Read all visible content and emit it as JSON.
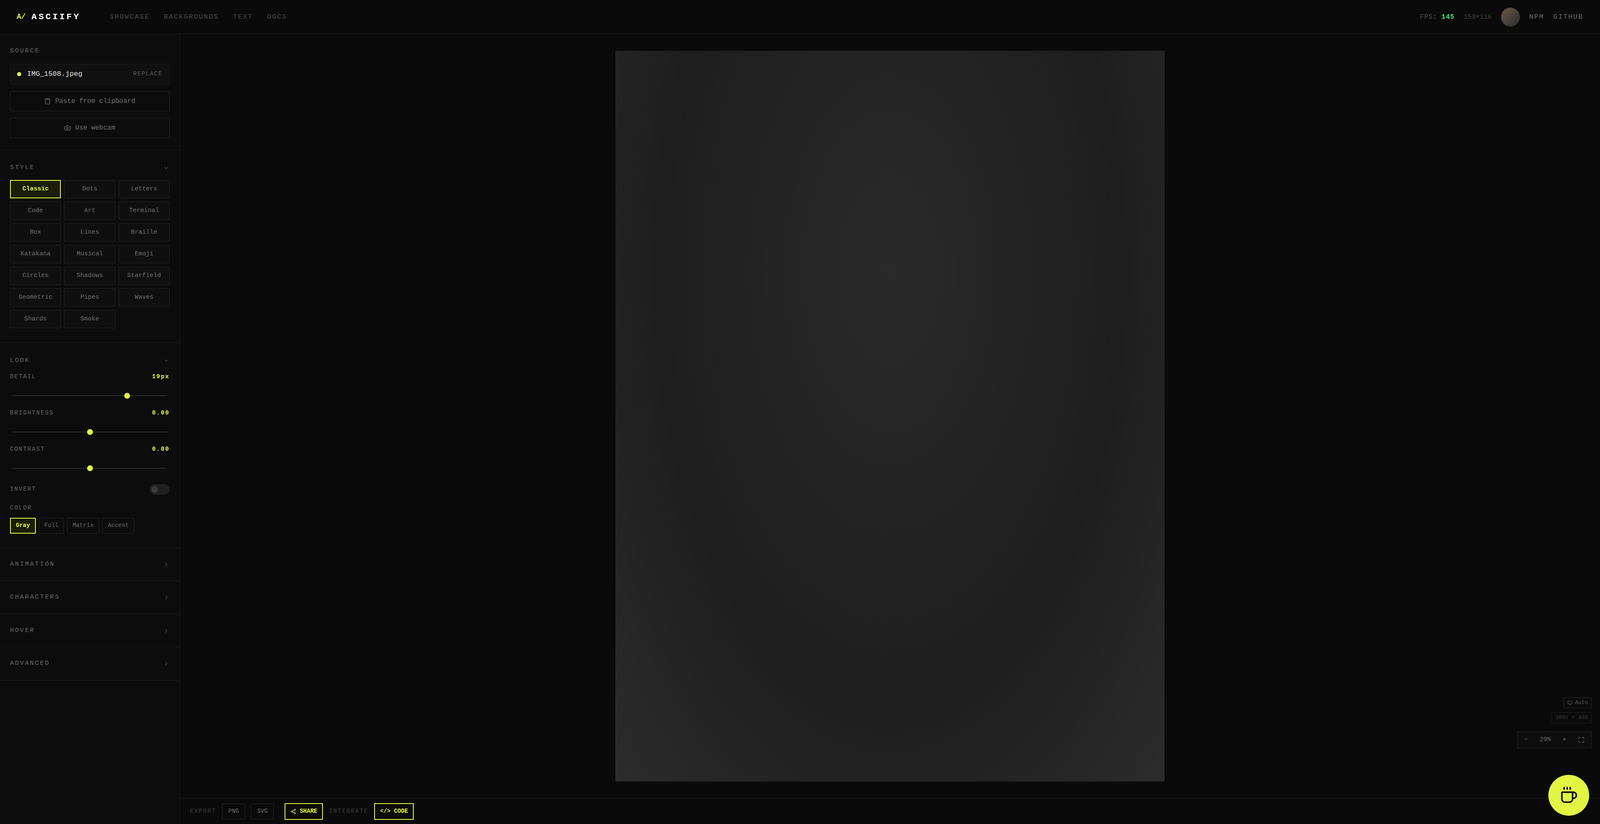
{
  "header": {
    "logo_mark": "A/",
    "title": "ASCIIFY",
    "nav": [
      {
        "label": "SHOWCASE"
      },
      {
        "label": "BACKGROUNDS"
      },
      {
        "label": "TEXT"
      },
      {
        "label": "DOCS"
      }
    ],
    "fps_label": "FPS:",
    "fps_value": "145",
    "grid_size": "159×116",
    "links": [
      "NPM",
      "GITHUB"
    ]
  },
  "sidebar": {
    "source": {
      "label": "SOURCE",
      "file_name": "IMG_1508.jpeg",
      "replace": "REPLACE",
      "buttons": [
        {
          "label": "Paste from clipboard",
          "kind": "clipboard"
        },
        {
          "label": "Use webcam",
          "kind": "webcam"
        }
      ]
    },
    "style": {
      "label": "STYLE",
      "expanded": true,
      "options": [
        {
          "label": "Classic",
          "selected": true
        },
        {
          "label": "Dots",
          "selected": false
        },
        {
          "label": "Letters",
          "selected": false
        },
        {
          "label": "Code",
          "selected": false
        },
        {
          "label": "Art",
          "selected": false
        },
        {
          "label": "Terminal",
          "selected": false
        },
        {
          "label": "Box",
          "selected": false
        },
        {
          "label": "Lines",
          "selected": false
        },
        {
          "label": "Braille",
          "selected": false
        },
        {
          "label": "Katakana",
          "selected": false
        },
        {
          "label": "Musical",
          "selected": false
        },
        {
          "label": "Emoji",
          "selected": false
        },
        {
          "label": "Circles",
          "selected": false
        },
        {
          "label": "Shadows",
          "selected": false
        },
        {
          "label": "Starfield",
          "selected": false
        },
        {
          "label": "Geometric",
          "selected": false
        },
        {
          "label": "Pipes",
          "selected": false
        },
        {
          "label": "Waves",
          "selected": false
        },
        {
          "label": "Shards",
          "selected": false
        },
        {
          "label": "Smoke",
          "selected": false
        }
      ]
    },
    "look": {
      "label": "LOOK",
      "expanded": true,
      "sliders": [
        {
          "label": "DETAIL",
          "reading": "19px",
          "level": 0.74
        },
        {
          "label": "BRIGHTNESS",
          "reading": "0.00",
          "level": 0.5
        },
        {
          "label": "CONTRAST",
          "reading": "0.00",
          "level": 0.5
        }
      ],
      "invert": {
        "label": "INVERT",
        "on": false
      },
      "color": {
        "label": "COLOR",
        "options": [
          {
            "label": "Gray",
            "selected": true
          },
          {
            "label": "Full",
            "selected": false
          },
          {
            "label": "Matrix",
            "selected": false
          },
          {
            "label": "Accent",
            "selected": false
          }
        ]
      }
    },
    "sections": [
      {
        "label": "ANIMATION",
        "expanded": false
      },
      {
        "label": "CHARACTERS",
        "expanded": false
      },
      {
        "label": "HOVER",
        "expanded": false
      },
      {
        "label": "ADVANCED",
        "expanded": false
      }
    ]
  },
  "canvas": {
    "auto_button": "Auto",
    "dimensions": "360c × 403",
    "zoom": {
      "minus": "−",
      "value": "29%",
      "plus": "+"
    }
  },
  "bottom_bar": {
    "export_label": "EXPORT",
    "export_buttons": [
      "PNG",
      "SVG"
    ],
    "share": "SHARE",
    "integrate_label": "INTEGRATE",
    "code": "</> CODE"
  }
}
